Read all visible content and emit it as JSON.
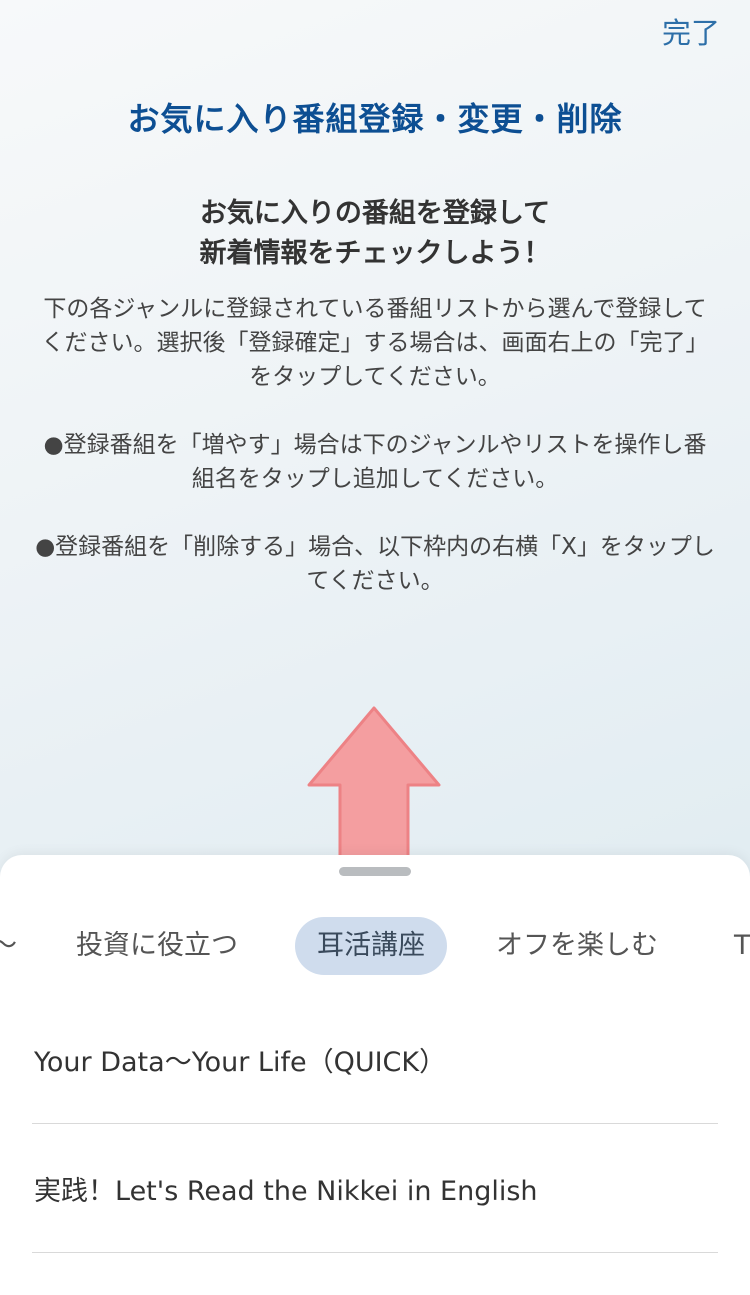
{
  "header": {
    "done_label": "完了",
    "title": "お気に入り番組登録・変更・削除"
  },
  "intro": {
    "headline_line1": "お気に入りの番組を登録して",
    "headline_line2": "新着情報をチェックしよう！",
    "paragraphs": [
      "下の各ジャンルに登録されている番組リストから選んで登録してください。選択後「登録確定」する場合は、画面右上の「完了」をタップしてください。",
      "●登録番組を「増やす」場合は下のジャンルやリストを操作し番組名をタップし追加してください。",
      "●登録番組を「削除する」場合、以下枠内の右横「X」をタップしてください。"
    ]
  },
  "arrow": {
    "color": "#f59a9c",
    "icon": "up-arrow"
  },
  "sheet": {
    "tabs": [
      {
        "label": "〜",
        "active": false
      },
      {
        "label": "投資に役立つ",
        "active": false
      },
      {
        "label": "耳活講座",
        "active": true
      },
      {
        "label": "オフを楽しむ",
        "active": false
      },
      {
        "label": "T",
        "active": false
      }
    ],
    "programs": [
      {
        "title": "Your Data～Your Life（QUICK）"
      },
      {
        "title": "実践！Let's Read the Nikkei in English"
      }
    ]
  },
  "colors": {
    "accent": "#0d4f93",
    "link": "#2d6fa8",
    "active_tab_bg": "#cfdced"
  }
}
